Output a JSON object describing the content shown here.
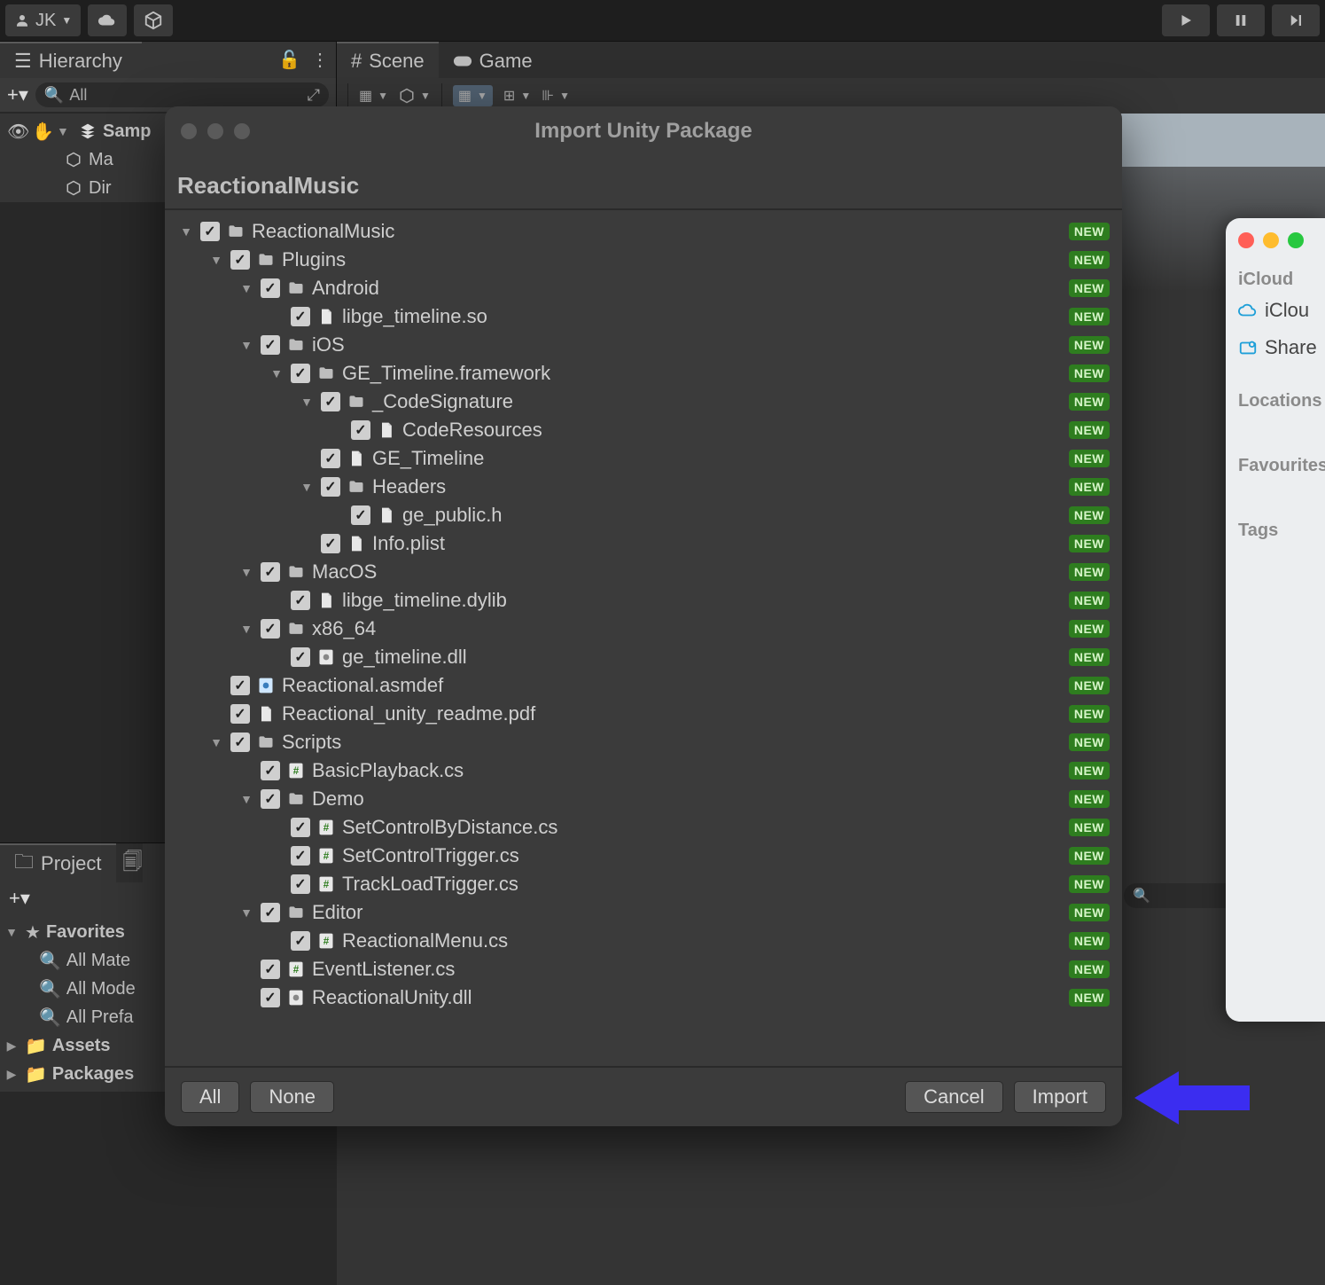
{
  "topbar": {
    "account_initials": "JK"
  },
  "hierarchy": {
    "tab_label": "Hierarchy",
    "search_placeholder": "All",
    "items": [
      {
        "label": "Samp",
        "folded": false
      },
      {
        "label": "Ma"
      },
      {
        "label": "Dir"
      }
    ]
  },
  "scene_tabs": {
    "scene": "Scene",
    "game": "Game"
  },
  "project": {
    "tab_label": "Project",
    "favorites_label": "Favorites",
    "favorites": [
      "All Mate",
      "All Mode",
      "All Prefa"
    ],
    "roots": [
      "Assets",
      "Packages"
    ]
  },
  "dialog": {
    "title": "Import Unity Package",
    "package_name": "ReactionalMusic",
    "buttons": {
      "all": "All",
      "none": "None",
      "cancel": "Cancel",
      "import": "Import"
    },
    "badge": "NEW",
    "tree": [
      {
        "d": 0,
        "f": true,
        "t": "folder",
        "label": "ReactionalMusic"
      },
      {
        "d": 1,
        "f": true,
        "t": "folder",
        "label": "Plugins"
      },
      {
        "d": 2,
        "f": true,
        "t": "folder",
        "label": "Android"
      },
      {
        "d": 3,
        "f": false,
        "t": "file",
        "label": "libge_timeline.so"
      },
      {
        "d": 2,
        "f": true,
        "t": "folder",
        "label": "iOS"
      },
      {
        "d": 3,
        "f": true,
        "t": "folder",
        "label": "GE_Timeline.framework"
      },
      {
        "d": 4,
        "f": true,
        "t": "folder",
        "label": "_CodeSignature"
      },
      {
        "d": 5,
        "f": false,
        "t": "file",
        "label": "CodeResources"
      },
      {
        "d": 4,
        "f": false,
        "t": "file",
        "label": "GE_Timeline"
      },
      {
        "d": 4,
        "f": true,
        "t": "folder",
        "label": "Headers"
      },
      {
        "d": 5,
        "f": false,
        "t": "file",
        "label": "ge_public.h"
      },
      {
        "d": 4,
        "f": false,
        "t": "file",
        "label": "Info.plist"
      },
      {
        "d": 2,
        "f": true,
        "t": "folder",
        "label": "MacOS"
      },
      {
        "d": 3,
        "f": false,
        "t": "file",
        "label": "libge_timeline.dylib"
      },
      {
        "d": 2,
        "f": true,
        "t": "folder",
        "label": "x86_64"
      },
      {
        "d": 3,
        "f": false,
        "t": "dll",
        "label": "ge_timeline.dll"
      },
      {
        "d": 1,
        "f": false,
        "t": "asm",
        "label": "Reactional.asmdef"
      },
      {
        "d": 1,
        "f": false,
        "t": "file",
        "label": "Reactional_unity_readme.pdf"
      },
      {
        "d": 1,
        "f": true,
        "t": "folder",
        "label": "Scripts"
      },
      {
        "d": 2,
        "f": false,
        "t": "cs",
        "label": "BasicPlayback.cs"
      },
      {
        "d": 2,
        "f": true,
        "t": "folder",
        "label": "Demo"
      },
      {
        "d": 3,
        "f": false,
        "t": "cs",
        "label": "SetControlByDistance.cs"
      },
      {
        "d": 3,
        "f": false,
        "t": "cs",
        "label": "SetControlTrigger.cs"
      },
      {
        "d": 3,
        "f": false,
        "t": "cs",
        "label": "TrackLoadTrigger.cs"
      },
      {
        "d": 2,
        "f": true,
        "t": "folder",
        "label": "Editor"
      },
      {
        "d": 3,
        "f": false,
        "t": "cs",
        "label": "ReactionalMenu.cs"
      },
      {
        "d": 2,
        "f": false,
        "t": "cs",
        "label": "EventListener.cs"
      },
      {
        "d": 2,
        "f": false,
        "t": "dll",
        "label": "ReactionalUnity.dll"
      }
    ]
  },
  "finder": {
    "sections": {
      "icloud": "iCloud",
      "icloud_items": [
        "iClou",
        "Share"
      ],
      "locations": "Locations",
      "favourites": "Favourites",
      "tags": "Tags"
    }
  }
}
